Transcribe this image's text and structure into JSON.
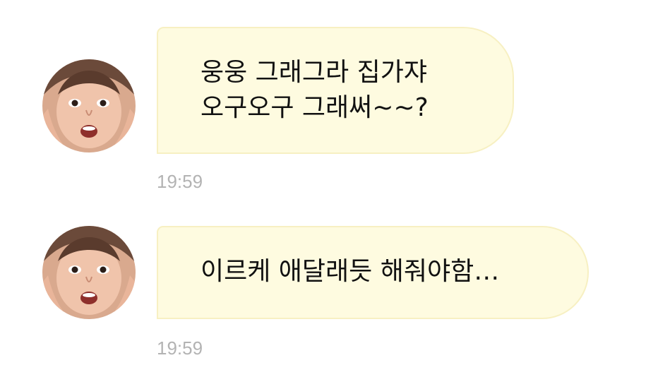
{
  "theme": {
    "bubble_color": "#fefbe0",
    "bubble_border": "#f7f0c2",
    "time_color": "#b3b3b3"
  },
  "messages": [
    {
      "avatar_icon": "profile-photo-avatar",
      "lines": [
        "웅웅 그래그라 집가쟈",
        "오구오구 그래써~~?"
      ],
      "time": "19:59"
    },
    {
      "avatar_icon": "profile-photo-avatar",
      "lines": [
        "이르케 애달래듯 해줘야함…"
      ],
      "time": "19:59"
    }
  ]
}
